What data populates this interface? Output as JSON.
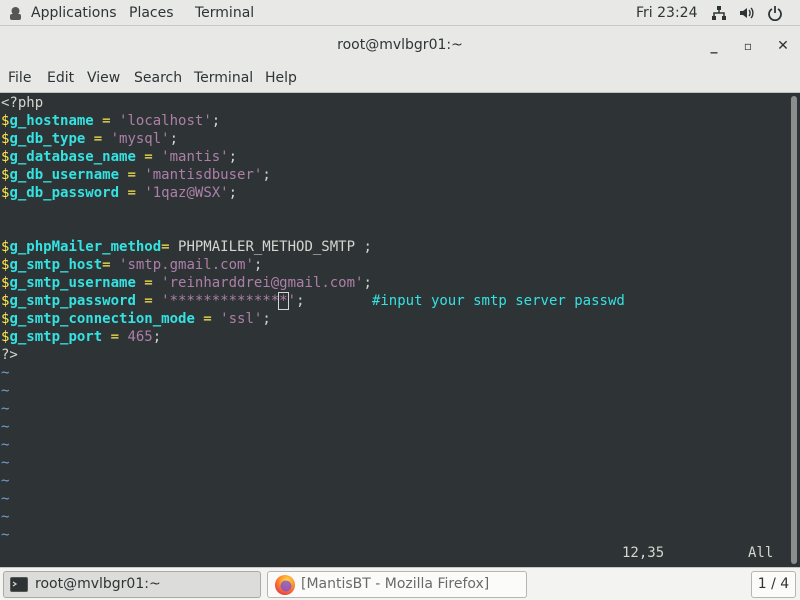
{
  "topbar": {
    "applications": "Applications",
    "places": "Places",
    "terminal": "Terminal",
    "clock": "Fri 23:24",
    "icons": [
      "network-icon",
      "volume-icon",
      "power-icon"
    ]
  },
  "window": {
    "title": "root@mvlbgr01:~",
    "controls": {
      "minimize": "_",
      "maximize": "▫",
      "close": "✕"
    }
  },
  "menubar": {
    "items": [
      "File",
      "Edit",
      "View",
      "Search",
      "Terminal",
      "Help"
    ]
  },
  "editor": {
    "lines": [
      {
        "type": "plain",
        "text": "<?php"
      },
      {
        "type": "assign",
        "var": "g_hostname",
        "op": " = ",
        "val": "'localhost'",
        "end": ";"
      },
      {
        "type": "assign",
        "var": "g_db_type",
        "op": " = ",
        "val": "'mysql'",
        "end": ";"
      },
      {
        "type": "assign",
        "var": "g_database_name",
        "op": " = ",
        "val": "'mantis'",
        "end": ";"
      },
      {
        "type": "assign",
        "var": "g_db_username",
        "op": " = ",
        "val": "'mantisdbuser'",
        "end": ";"
      },
      {
        "type": "assign",
        "var": "g_db_password",
        "op": " = ",
        "val": "'1qaz@WSX'",
        "end": ";"
      },
      {
        "type": "blank"
      },
      {
        "type": "blank"
      },
      {
        "type": "assignplain",
        "var": "g_phpMailer_method",
        "op": "=",
        "val": " PHPMAILER_METHOD_SMTP ;"
      },
      {
        "type": "assign",
        "var": "g_smtp_host",
        "op": "= ",
        "val": "'smtp.gmail.com'",
        "end": ";"
      },
      {
        "type": "assign",
        "var": "g_smtp_username",
        "op": " = ",
        "val": "'reinharddrei@gmail.com'",
        "end": ";"
      },
      {
        "type": "password",
        "var": "g_smtp_password",
        "op": " = ",
        "val_a": "'*************",
        "val_cursor": "*",
        "val_b": "'",
        "end": ";",
        "gap": "        ",
        "comment": "#input your smtp server passwd"
      },
      {
        "type": "assign",
        "var": "g_smtp_connection_mode",
        "op": " = ",
        "val": "'ssl'",
        "end": ";"
      },
      {
        "type": "assignnum",
        "var": "g_smtp_port",
        "op": " = ",
        "val": "465",
        "end": ";"
      },
      {
        "type": "plain",
        "text": "?>"
      }
    ],
    "tildes": [
      "~",
      "~",
      "~",
      "~",
      "~",
      "~",
      "~",
      "~",
      "~",
      "~"
    ],
    "status_pos": "12,35",
    "status_all": "All"
  },
  "taskbar": {
    "tasks": [
      {
        "label": "root@mvlbgr01:~",
        "icon": "terminal-icon",
        "active": true
      },
      {
        "label": "[MantisBT - Mozilla Firefox]",
        "icon": "firefox-icon",
        "active": false
      }
    ],
    "pager": "1 / 4"
  },
  "colors": {
    "terminal_bg": "#2e3436",
    "variable": "#34e2e2",
    "dollar": "#fce94f",
    "string": "#ad7fa8",
    "tilde": "#729fcf"
  }
}
